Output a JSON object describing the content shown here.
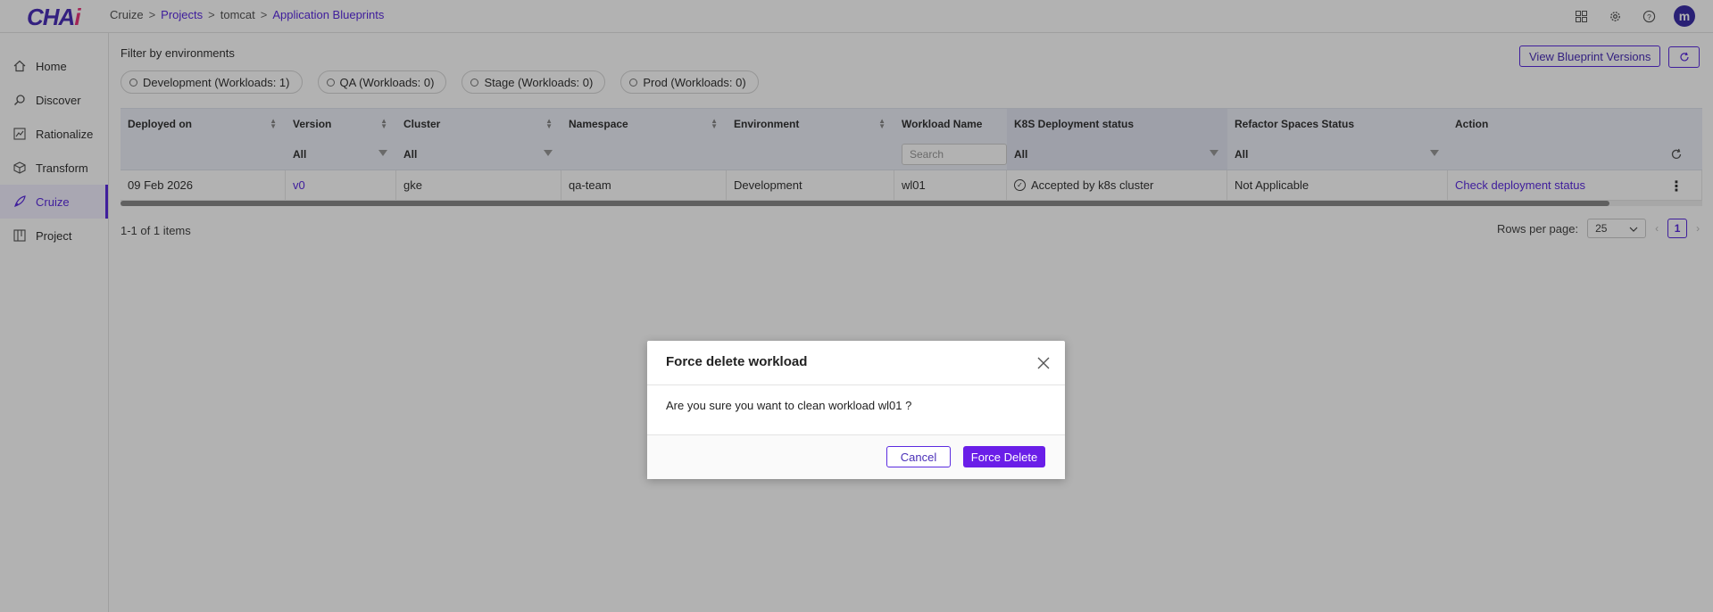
{
  "app": {
    "logo_main": "CHA",
    "logo_accent": "i"
  },
  "breadcrumb": [
    "Cruize",
    "Projects",
    "tomcat",
    "Application Blueprints"
  ],
  "avatar_initial": "m",
  "sidebar": {
    "items": [
      {
        "label": "Home",
        "icon": "home-icon"
      },
      {
        "label": "Discover",
        "icon": "telescope-icon"
      },
      {
        "label": "Rationalize",
        "icon": "chart-icon"
      },
      {
        "label": "Transform",
        "icon": "cube-icon"
      },
      {
        "label": "Cruize",
        "icon": "rocket-icon",
        "active": true
      },
      {
        "label": "Project",
        "icon": "board-icon"
      }
    ]
  },
  "filters": {
    "label": "Filter by environments",
    "chips": [
      "Development (Workloads: 1)",
      "QA (Workloads: 0)",
      "Stage (Workloads: 0)",
      "Prod (Workloads: 0)"
    ]
  },
  "toolbar": {
    "view_versions": "View Blueprint Versions"
  },
  "table": {
    "headers": [
      "Deployed on",
      "Version",
      "Cluster",
      "Namespace",
      "Environment",
      "Workload Name",
      "K8S Deployment status",
      "Refactor Spaces Status",
      "Action"
    ],
    "filters": {
      "version": "All",
      "cluster": "All",
      "workload_placeholder": "Search",
      "k8s": "All",
      "refactor": "All"
    },
    "rows": [
      {
        "deployed_on": "09 Feb 2026",
        "version": "v0",
        "cluster": "gke",
        "namespace": "qa-team",
        "environment": "Development",
        "workload": "wl01",
        "k8s_status": "Accepted by k8s cluster",
        "refactor_status": "Not Applicable",
        "action": "Check deployment status"
      }
    ]
  },
  "pagination": {
    "summary": "1-1 of 1 items",
    "rows_per_page_label": "Rows per page:",
    "rows_per_page": "25",
    "current_page": "1"
  },
  "modal": {
    "title": "Force delete workload",
    "message": "Are you sure you want to clean workload wl01 ?",
    "cancel": "Cancel",
    "confirm": "Force Delete"
  }
}
